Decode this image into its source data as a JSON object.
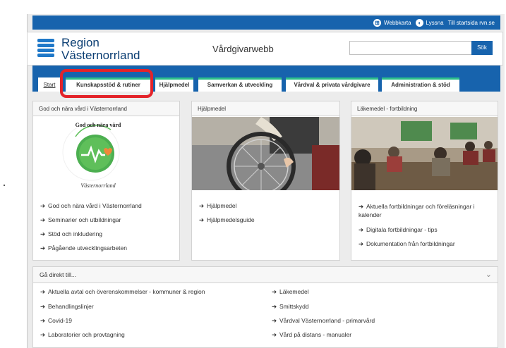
{
  "topbar": {
    "links": [
      {
        "icon": "sitemap-icon",
        "label": "Webbkarta"
      },
      {
        "icon": "speaker-icon",
        "label": "Lyssna"
      },
      {
        "label": "Till startsida rvn.se"
      }
    ]
  },
  "header": {
    "brand_line1": "Region",
    "brand_line2": "Västernorrland",
    "subtitle": "Vårdgivarwebb",
    "search": {
      "value": "",
      "placeholder": "",
      "button": "Sök"
    }
  },
  "tabs": [
    {
      "label": "Start",
      "active": true
    },
    {
      "label": "Kunskapsstöd & rutiner",
      "highlighted": true
    },
    {
      "label": "Hjälpmedel"
    },
    {
      "label": "Samverkan & utveckling"
    },
    {
      "label": "Vårdval & privata vårdgivare"
    },
    {
      "label": "Administration & stöd"
    }
  ],
  "cards": [
    {
      "title": "God och nära vård i Västernorrland",
      "image": {
        "type": "badge-logo",
        "text_top": "God och nära vård",
        "text_bottom": "Västernorrland"
      },
      "links": [
        "God och nära vård i Västernorrland",
        "Seminarier och utbildningar",
        "Stöd och inkludering",
        "Pågående utvecklingsarbeten"
      ]
    },
    {
      "title": "Hjälpmedel",
      "image": {
        "type": "photo",
        "subject": "wheelchair-wheel"
      },
      "links": [
        "Hjälpmedel",
        "Hjälpmedelsguide"
      ]
    },
    {
      "title": "Läkemedel - fortbildning",
      "image": {
        "type": "photo",
        "subject": "lecture-audience"
      },
      "links": [
        "Aktuella fortbildningar och föreläsningar i kalender",
        "Digitala fortbildningar - tips",
        "Dokumentation från fortbildningar"
      ]
    }
  ],
  "shortcuts": {
    "title": "Gå direkt till...",
    "col1": [
      "Aktuella avtal och överenskommelser - kommuner & region",
      "Behandlingslinjer",
      "Covid-19",
      "Laboratorier och provtagning"
    ],
    "col2": [
      "Läkemedel",
      "Smittskydd",
      "Vårdval Västernorrland - primarvård",
      "Vård på distans - manualer"
    ]
  },
  "colors": {
    "brand_blue": "#1763ad",
    "tab_accent": "#2dbf8a",
    "highlight_red": "#e3232a"
  }
}
